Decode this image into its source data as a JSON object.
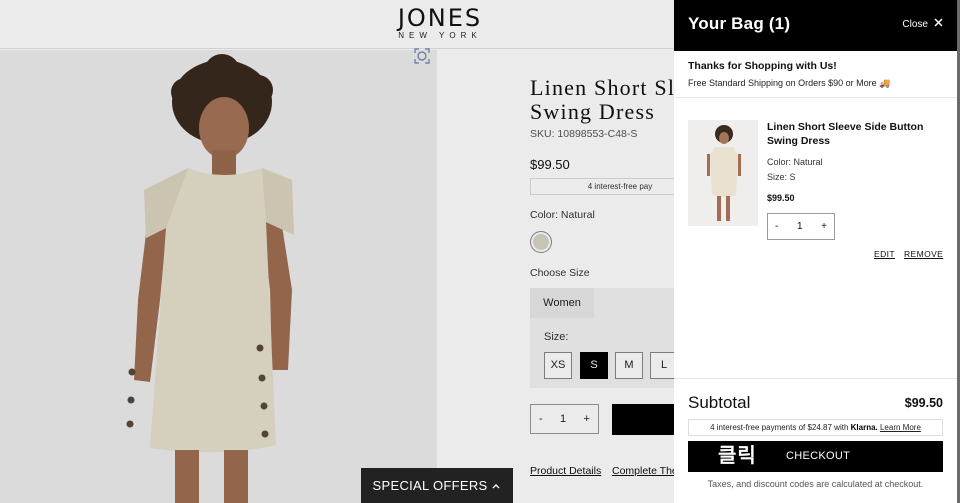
{
  "site": {
    "brand": "JONES",
    "brand_sub": "NEW YORK"
  },
  "product": {
    "title_line1": "Linen Short Sl",
    "title_line2": "Swing Dress",
    "sku": "SKU: 10898553-C48-S",
    "price": "$99.50",
    "klarna_strip": "4 interest-free pay",
    "color_label": "Color:  Natural",
    "choose_size": "Choose Size",
    "size_tab": "Women",
    "size_label": "Size:",
    "sizes": [
      "XS",
      "S",
      "M",
      "L"
    ],
    "selected_size": "S",
    "quantity": "1",
    "minus": "-",
    "plus": "+",
    "tabs": [
      "Product Details",
      "Complete The"
    ]
  },
  "special_offers": "SPECIAL OFFERS",
  "cart": {
    "title": "Your Bag (1)",
    "close_label": "Close",
    "promo_title": "Thanks for Shopping with Us!",
    "promo_shipping": "Free Standard Shipping on Orders $90 or More 🚚",
    "item": {
      "name": "Linen Short Sleeve Side Button Swing Dress",
      "color": "Color: Natural",
      "size": "Size: S",
      "price": "$99.50",
      "quantity": "1",
      "minus": "-",
      "plus": "+",
      "edit": "EDIT",
      "remove": "REMOVE"
    },
    "subtotal_label": "Subtotal",
    "subtotal_value": "$99.50",
    "klarna_text": "4 interest-free payments of $24.87 with ",
    "klarna_brand": "Klarna.",
    "klarna_link": "Learn More",
    "checkout_badge": "클릭",
    "checkout_label": "CHECKOUT",
    "tax_note": "Taxes, and discount codes are calculated at checkout."
  },
  "colors": {
    "swatch_natural": "#d8d4c5",
    "header_bg": "#000000",
    "accent": "#000000"
  }
}
